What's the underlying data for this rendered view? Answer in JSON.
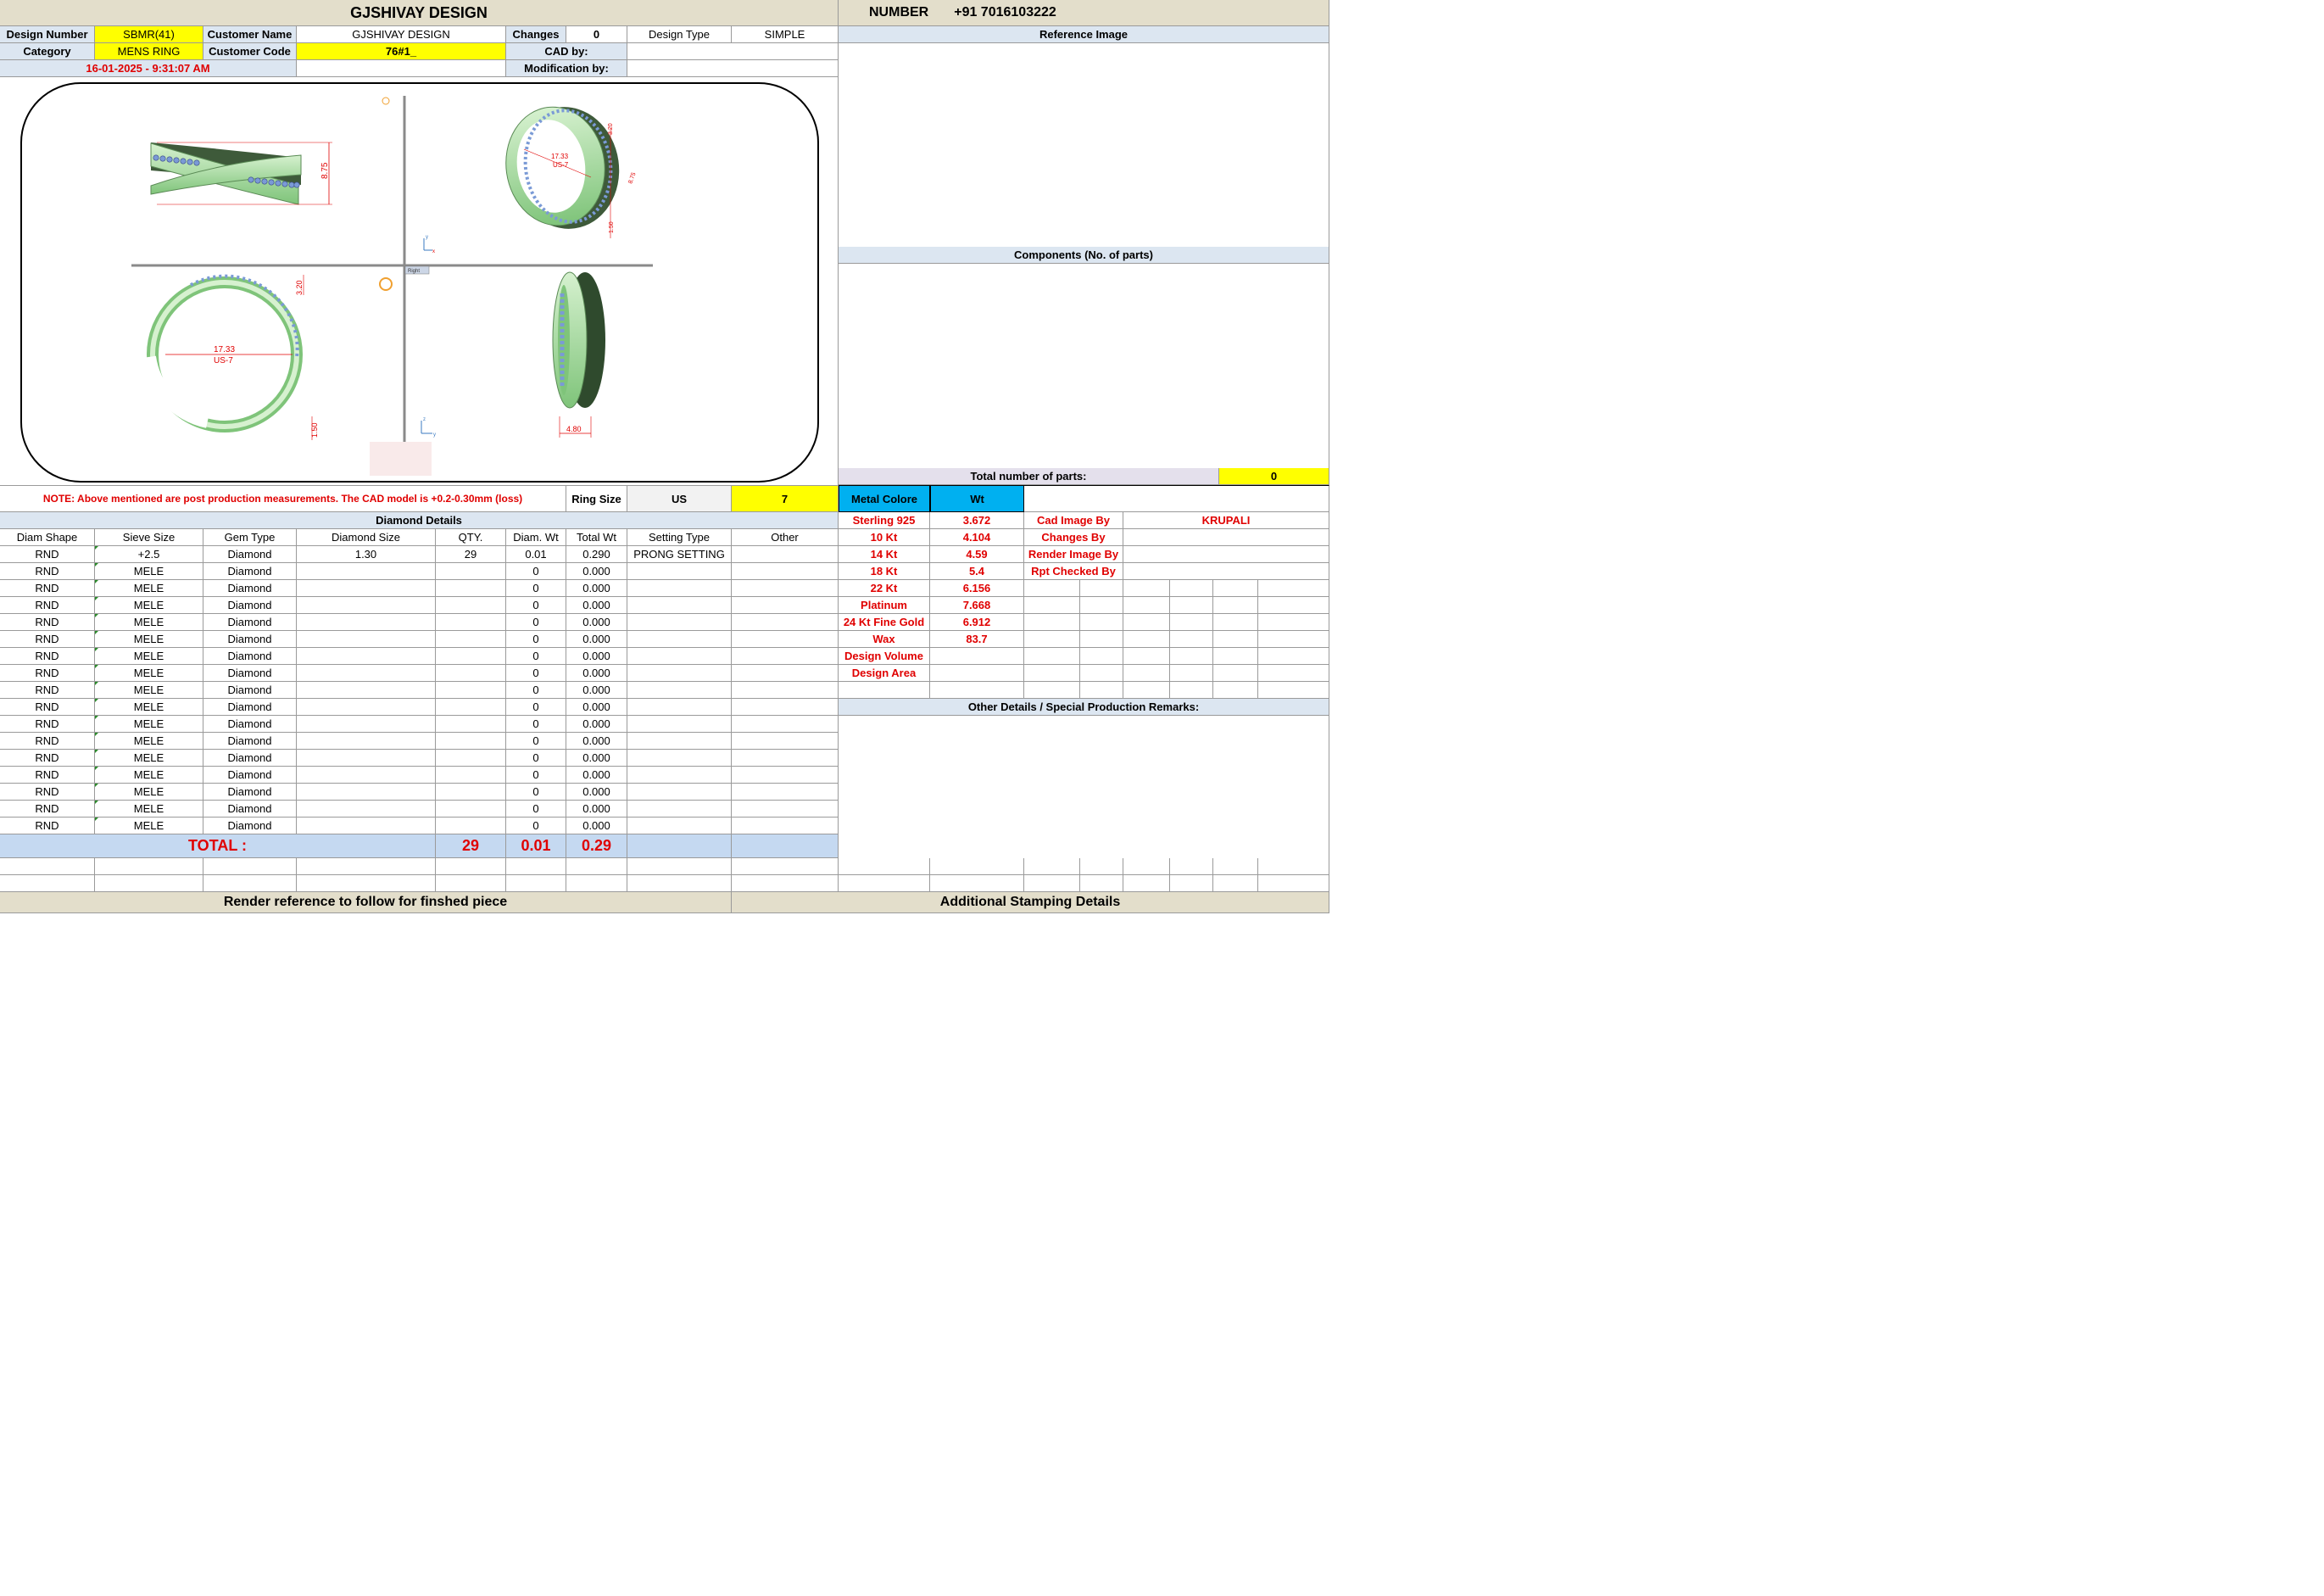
{
  "header": {
    "title": "GJSHIVAY DESIGN",
    "number_label": "NUMBER",
    "number_value": "+91 7016103222"
  },
  "info": {
    "design_number_label": "Design Number",
    "design_number": "SBMR(41)",
    "customer_name_label": "Customer Name",
    "customer_name": "GJSHIVAY DESIGN",
    "changes_label": "Changes",
    "changes_value": "0",
    "design_type_label": "Design Type",
    "design_type": "SIMPLE",
    "category_label": "Category",
    "category": "MENS RING",
    "customer_code_label": "Customer Code",
    "customer_code": "76#1_",
    "cad_by_label": "CAD by:",
    "modification_by_label": "Modification by:",
    "timestamp": "16-01-2025 - 9:31:07 AM"
  },
  "right_panel": {
    "reference_image": "Reference Image",
    "components": "Components (No. of parts)",
    "total_parts_label": "Total number of parts:",
    "total_parts": "0",
    "metal_colore": "Metal Colore",
    "wt": "Wt",
    "metals": [
      {
        "name": "Sterling 925",
        "wt": "3.672"
      },
      {
        "name": "10 Kt",
        "wt": "4.104"
      },
      {
        "name": "14 Kt",
        "wt": "4.59"
      },
      {
        "name": "18 Kt",
        "wt": "5.4"
      },
      {
        "name": "22 Kt",
        "wt": "6.156"
      },
      {
        "name": "Platinum",
        "wt": "7.668"
      },
      {
        "name": "24 Kt Fine Gold",
        "wt": "6.912"
      },
      {
        "name": "Wax",
        "wt": "83.7"
      },
      {
        "name": "Design Volume",
        "wt": ""
      },
      {
        "name": "Design Area",
        "wt": ""
      }
    ],
    "credits": [
      {
        "label": "Cad Image By",
        "value": "KRUPALI"
      },
      {
        "label": "Changes By",
        "value": ""
      },
      {
        "label": "Render Image By",
        "value": ""
      },
      {
        "label": "Rpt Checked By",
        "value": ""
      }
    ],
    "other_details": "Other Details / Special Production Remarks:"
  },
  "note": "NOTE: Above mentioned are post production measurements. The CAD model is +0.2-0.30mm (loss)",
  "ring_size": {
    "label": "Ring Size",
    "system": "US",
    "value": "7"
  },
  "diamond": {
    "title": "Diamond Details",
    "columns": [
      "Diam Shape",
      "Sieve Size",
      "Gem Type",
      "Diamond Size",
      "QTY.",
      "Diam. Wt",
      "Total Wt",
      "Setting Type",
      "Other"
    ],
    "rows": [
      [
        "RND",
        "+2.5",
        "Diamond",
        "1.30",
        "29",
        "0.01",
        "0.290",
        "PRONG SETTING",
        ""
      ],
      [
        "RND",
        "MELE",
        "Diamond",
        "",
        "",
        "0",
        "0.000",
        "",
        ""
      ],
      [
        "RND",
        "MELE",
        "Diamond",
        "",
        "",
        "0",
        "0.000",
        "",
        ""
      ],
      [
        "RND",
        "MELE",
        "Diamond",
        "",
        "",
        "0",
        "0.000",
        "",
        ""
      ],
      [
        "RND",
        "MELE",
        "Diamond",
        "",
        "",
        "0",
        "0.000",
        "",
        ""
      ],
      [
        "RND",
        "MELE",
        "Diamond",
        "",
        "",
        "0",
        "0.000",
        "",
        ""
      ],
      [
        "RND",
        "MELE",
        "Diamond",
        "",
        "",
        "0",
        "0.000",
        "",
        ""
      ],
      [
        "RND",
        "MELE",
        "Diamond",
        "",
        "",
        "0",
        "0.000",
        "",
        ""
      ],
      [
        "RND",
        "MELE",
        "Diamond",
        "",
        "",
        "0",
        "0.000",
        "",
        ""
      ],
      [
        "RND",
        "MELE",
        "Diamond",
        "",
        "",
        "0",
        "0.000",
        "",
        ""
      ],
      [
        "RND",
        "MELE",
        "Diamond",
        "",
        "",
        "0",
        "0.000",
        "",
        ""
      ],
      [
        "RND",
        "MELE",
        "Diamond",
        "",
        "",
        "0",
        "0.000",
        "",
        ""
      ],
      [
        "RND",
        "MELE",
        "Diamond",
        "",
        "",
        "0",
        "0.000",
        "",
        ""
      ],
      [
        "RND",
        "MELE",
        "Diamond",
        "",
        "",
        "0",
        "0.000",
        "",
        ""
      ],
      [
        "RND",
        "MELE",
        "Diamond",
        "",
        "",
        "0",
        "0.000",
        "",
        ""
      ],
      [
        "RND",
        "MELE",
        "Diamond",
        "",
        "",
        "0",
        "0.000",
        "",
        ""
      ],
      [
        "RND",
        "MELE",
        "Diamond",
        "",
        "",
        "0",
        "0.000",
        "",
        ""
      ]
    ],
    "total_label": "TOTAL :",
    "total_qty": "29",
    "total_diam_wt": "0.01",
    "total_wt": "0.29"
  },
  "footer": {
    "render_reference": "Render reference to follow for finshed piece",
    "stamping": "Additional Stamping Details"
  },
  "cad": {
    "dim_height": "8.75",
    "dim_diameter": "17.33",
    "dim_us": "US-7",
    "dim_top": "3.20",
    "dim_bottom": "1.50",
    "dim_width": "4.80",
    "view_label": "Right",
    "iso_dim_a": "3.20",
    "iso_dim_b": "8.75",
    "iso_dim_c": "1.50",
    "axis_x": "x",
    "axis_y": "y",
    "axis_z": "z"
  },
  "colors": {
    "header_bg": "#e3decb",
    "label_bg": "#dce6f1",
    "highlight": "#ffff00",
    "metal_header": "#00b0f0",
    "red_text": "#e00000",
    "ring_green": "#a9dca0",
    "stone_blue": "#7a9ad6"
  }
}
